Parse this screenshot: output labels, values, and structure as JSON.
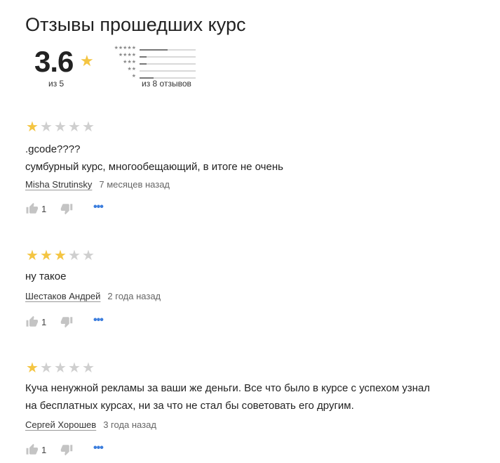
{
  "title": "Отзывы прошедших курс",
  "summary": {
    "average": "3.6",
    "out_of": "из 5",
    "count_text": "из 8 отзывов",
    "star_color": "#f4c542",
    "histogram": [
      {
        "stars": 5,
        "label": "★★★★★",
        "fraction": 0.5
      },
      {
        "stars": 4,
        "label": "★★★★",
        "fraction": 0.12
      },
      {
        "stars": 3,
        "label": "★★★",
        "fraction": 0.12
      },
      {
        "stars": 2,
        "label": "★★",
        "fraction": 0.0
      },
      {
        "stars": 1,
        "label": "★",
        "fraction": 0.25
      }
    ]
  },
  "reviews": [
    {
      "rating": 1,
      "lines": [
        ".gcode????",
        "сумбурный курс, многообещающий, в итоге не очень"
      ],
      "author": "Misha Strutinsky",
      "time": "7 месяцев назад",
      "likes": "1"
    },
    {
      "rating": 3,
      "lines": [
        "ну такое"
      ],
      "author": "Шестаков Андрей",
      "time": "2 года назад",
      "likes": "1"
    },
    {
      "rating": 1,
      "lines": [
        "Куча ненужной рекламы за ваши же деньги. Все что было в курсе с успехом узнал",
        "на бесплатных курсах, ни за что не стал бы советовать его другим."
      ],
      "author": "Сергей Хорошев",
      "time": "3 года назад",
      "likes": "1"
    }
  ],
  "icons": {
    "like": "thumbs-up-icon",
    "dislike": "thumbs-down-icon",
    "more": "more-dots-icon",
    "more_glyph": "•••",
    "star_glyph": "★"
  }
}
